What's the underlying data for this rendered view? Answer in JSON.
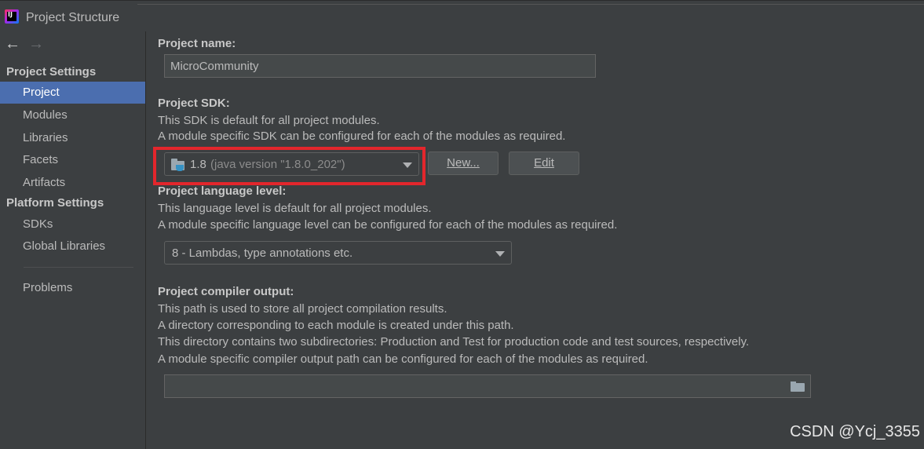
{
  "window": {
    "title": "Project Structure",
    "logo_text": "IJ"
  },
  "nav": {
    "back_icon": "arrow-left-icon",
    "forward_icon": "arrow-right-icon"
  },
  "sidebar": {
    "project_settings_header": "Project Settings",
    "project_settings_items": [
      {
        "label": "Project",
        "selected": true
      },
      {
        "label": "Modules",
        "selected": false
      },
      {
        "label": "Libraries",
        "selected": false
      },
      {
        "label": "Facets",
        "selected": false
      },
      {
        "label": "Artifacts",
        "selected": false
      }
    ],
    "platform_settings_header": "Platform Settings",
    "platform_settings_items": [
      {
        "label": "SDKs"
      },
      {
        "label": "Global Libraries"
      }
    ],
    "problems_label": "Problems"
  },
  "main": {
    "project_name": {
      "label": "Project name:",
      "value": "MicroCommunity"
    },
    "project_sdk": {
      "label": "Project SDK:",
      "desc1": "This SDK is default for all project modules.",
      "desc2": "A module specific SDK can be configured for each of the modules as required.",
      "selected_version": "1.8",
      "selected_detail": "(java version \"1.8.0_202\")",
      "new_button_label": "New...",
      "edit_button_label": "Edit"
    },
    "language_level": {
      "label": "Project language level:",
      "desc1": "This language level is default for all project modules.",
      "desc2": "A module specific language level can be configured for each of the modules as required.",
      "selected": "8 - Lambdas, type annotations etc."
    },
    "compiler_output": {
      "label": "Project compiler output:",
      "desc1": "This path is used to store all project compilation results.",
      "desc2": "A directory corresponding to each module is created under this path.",
      "desc3": "This directory contains two subdirectories: Production and Test for production code and test sources, respectively.",
      "desc4": "A module specific compiler output path can be configured for each of the modules as required.",
      "value": ""
    }
  },
  "colors": {
    "background": "#3c3f41",
    "selection": "#4b6eaf",
    "highlight_box": "#e3262c"
  },
  "watermark": "CSDN @Ycj_3355"
}
